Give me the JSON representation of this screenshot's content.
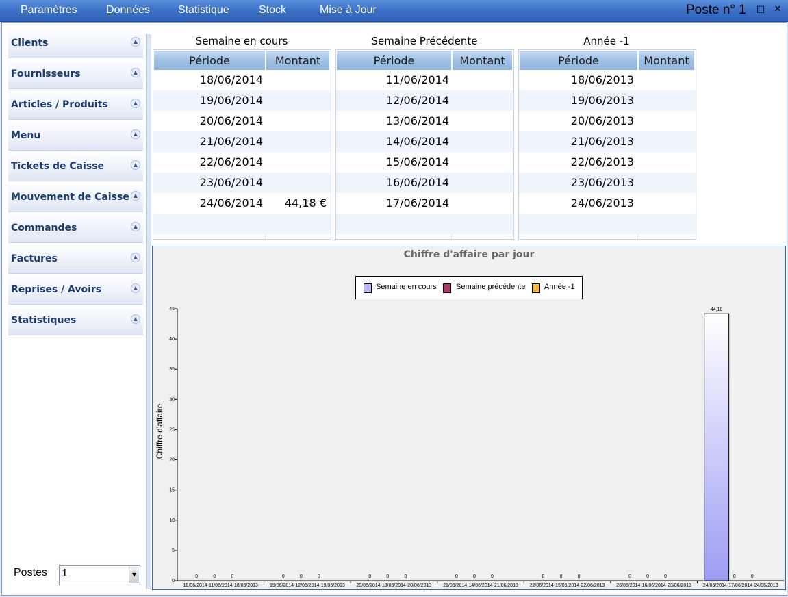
{
  "menu": {
    "items": [
      {
        "u": "P",
        "rest": "aramètres"
      },
      {
        "u": "D",
        "rest": "onnées"
      },
      {
        "u": "",
        "rest": "Statistique"
      },
      {
        "u": "S",
        "rest": "tock"
      },
      {
        "u": "M",
        "rest": "ise à Jour"
      }
    ],
    "window_title": "Poste n° 1",
    "restore_icon": "restore-icon",
    "close_icon": "close-icon"
  },
  "sidebar": {
    "items": [
      {
        "label": "Clients"
      },
      {
        "label": "Fournisseurs"
      },
      {
        "label": "Articles / Produits"
      },
      {
        "label": "Menu"
      },
      {
        "label": "Tickets de Caisse"
      },
      {
        "label": "Mouvement de Caisse"
      },
      {
        "label": "Commandes"
      },
      {
        "label": "Factures"
      },
      {
        "label": "Reprises / Avoirs"
      },
      {
        "label": "Statistiques"
      }
    ],
    "postes_label": "Postes",
    "postes_value": "1"
  },
  "tables": [
    {
      "title": "Semaine en cours",
      "col_periode": "Période",
      "col_montant": "Montant",
      "rows": [
        {
          "periode": "18/06/2014",
          "montant": ""
        },
        {
          "periode": "19/06/2014",
          "montant": ""
        },
        {
          "periode": "20/06/2014",
          "montant": ""
        },
        {
          "periode": "21/06/2014",
          "montant": ""
        },
        {
          "periode": "22/06/2014",
          "montant": ""
        },
        {
          "periode": "23/06/2014",
          "montant": ""
        },
        {
          "periode": "24/06/2014",
          "montant": "44,18 €"
        }
      ]
    },
    {
      "title": "Semaine Précédente",
      "col_periode": "Période",
      "col_montant": "Montant",
      "rows": [
        {
          "periode": "11/06/2014",
          "montant": ""
        },
        {
          "periode": "12/06/2014",
          "montant": ""
        },
        {
          "periode": "13/06/2014",
          "montant": ""
        },
        {
          "periode": "14/06/2014",
          "montant": ""
        },
        {
          "periode": "15/06/2014",
          "montant": ""
        },
        {
          "periode": "16/06/2014",
          "montant": ""
        },
        {
          "periode": "17/06/2014",
          "montant": ""
        }
      ]
    },
    {
      "title": "Année -1",
      "col_periode": "Période",
      "col_montant": "Montant",
      "rows": [
        {
          "periode": "18/06/2013",
          "montant": ""
        },
        {
          "periode": "19/06/2013",
          "montant": ""
        },
        {
          "periode": "20/06/2013",
          "montant": ""
        },
        {
          "periode": "21/06/2013",
          "montant": ""
        },
        {
          "periode": "22/06/2013",
          "montant": ""
        },
        {
          "periode": "23/06/2013",
          "montant": ""
        },
        {
          "periode": "24/06/2013",
          "montant": ""
        }
      ]
    }
  ],
  "chart_data": {
    "type": "bar",
    "title": "Chiffre d'affaire par jour",
    "ylabel": "Chiffre d'affaire",
    "xlabel": "",
    "ylim": [
      0,
      45
    ],
    "yticks": [
      0,
      5,
      10,
      15,
      20,
      25,
      30,
      35,
      40,
      45
    ],
    "grid": false,
    "legend_position": "top-center",
    "categories": [
      "18/06/2014-11/06/2014-18/06/2013",
      "19/06/2014-12/06/2014-19/06/2013",
      "20/06/2014-13/06/2014-20/06/2013",
      "21/06/2014-14/06/2014-21/06/2013",
      "22/06/2014-15/06/2014-22/06/2013",
      "23/06/2014-16/06/2014-23/06/2013",
      "24/06/2014-17/06/2014-24/06/2013"
    ],
    "series": [
      {
        "name": "Semaine en cours",
        "color": "#9c9cf4",
        "values": [
          0,
          0,
          0,
          0,
          0,
          0,
          44.18
        ],
        "labels": [
          "0",
          "0",
          "0",
          "0",
          "0",
          "0",
          "44,18"
        ]
      },
      {
        "name": "Semaine précédente",
        "color": "#b2386a",
        "values": [
          0,
          0,
          0,
          0,
          0,
          0,
          0
        ],
        "labels": [
          "0",
          "0",
          "0",
          "0",
          "0",
          "0",
          "0"
        ]
      },
      {
        "name": "Année -1",
        "color": "#f4b84a",
        "values": [
          0,
          0,
          0,
          0,
          0,
          0,
          0
        ],
        "labels": [
          "0",
          "0",
          "0",
          "0",
          "0",
          "0",
          "0"
        ]
      }
    ]
  }
}
